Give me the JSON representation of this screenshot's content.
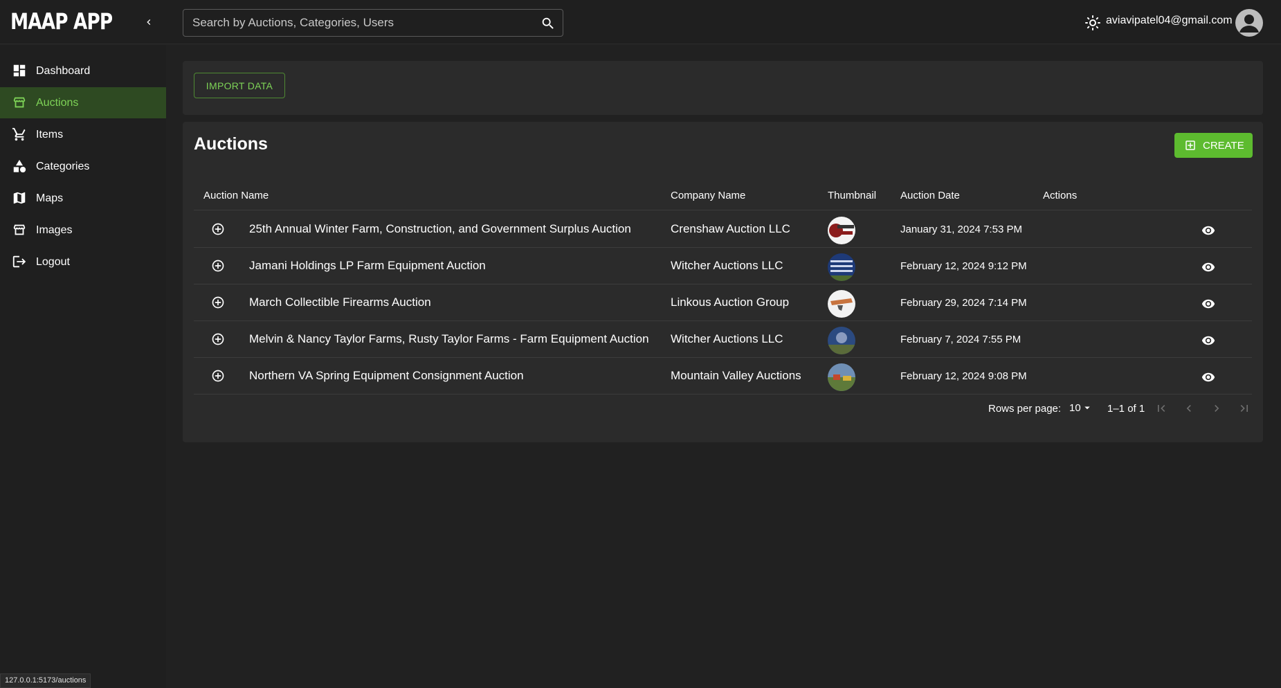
{
  "app": {
    "title": "MAAP APP"
  },
  "search": {
    "placeholder": "Search by Auctions, Categories, Users"
  },
  "user": {
    "email": "aviavipatel04@gmail.com"
  },
  "sidebar": {
    "items": [
      {
        "label": "Dashboard",
        "icon": "dashboard-icon"
      },
      {
        "label": "Auctions",
        "icon": "storefront-icon",
        "active": true
      },
      {
        "label": "Items",
        "icon": "cart-icon"
      },
      {
        "label": "Categories",
        "icon": "shapes-icon"
      },
      {
        "label": "Maps",
        "icon": "map-icon"
      },
      {
        "label": "Images",
        "icon": "storefront-icon"
      },
      {
        "label": "Logout",
        "icon": "logout-icon"
      }
    ]
  },
  "toolbar": {
    "import_label": "IMPORT DATA"
  },
  "table": {
    "title": "Auctions",
    "create_label": "CREATE",
    "columns": [
      "Auction Name",
      "Company Name",
      "Thumbnail",
      "Auction Date",
      "Actions"
    ],
    "rows": [
      {
        "name": "25th Annual Winter Farm, Construction, and Government Surplus Auction",
        "company": "Crenshaw Auction LLC",
        "date": "January 31, 2024 7:53 PM"
      },
      {
        "name": "Jamani Holdings LP Farm Equipment Auction",
        "company": "Witcher Auctions LLC",
        "date": "February 12, 2024 9:12 PM"
      },
      {
        "name": "March Collectible Firearms Auction",
        "company": "Linkous Auction Group",
        "date": "February 29, 2024 7:14 PM"
      },
      {
        "name": "Melvin & Nancy Taylor Farms, Rusty Taylor Farms - Farm Equipment Auction",
        "company": "Witcher Auctions LLC",
        "date": "February 7, 2024 7:55 PM"
      },
      {
        "name": "Northern VA Spring Equipment Consignment Auction",
        "company": "Mountain Valley Auctions",
        "date": "February 12, 2024 9:08 PM"
      }
    ]
  },
  "pagination": {
    "rows_per_page_label": "Rows per page:",
    "rows_per_page": "10",
    "range": "1–1 of 1"
  },
  "status_bar": {
    "url": "127.0.0.1:5173/auctions"
  },
  "colors": {
    "accent": "#5dbb2f",
    "accent_text": "#7ed357",
    "active_bg": "#2e4a22"
  }
}
